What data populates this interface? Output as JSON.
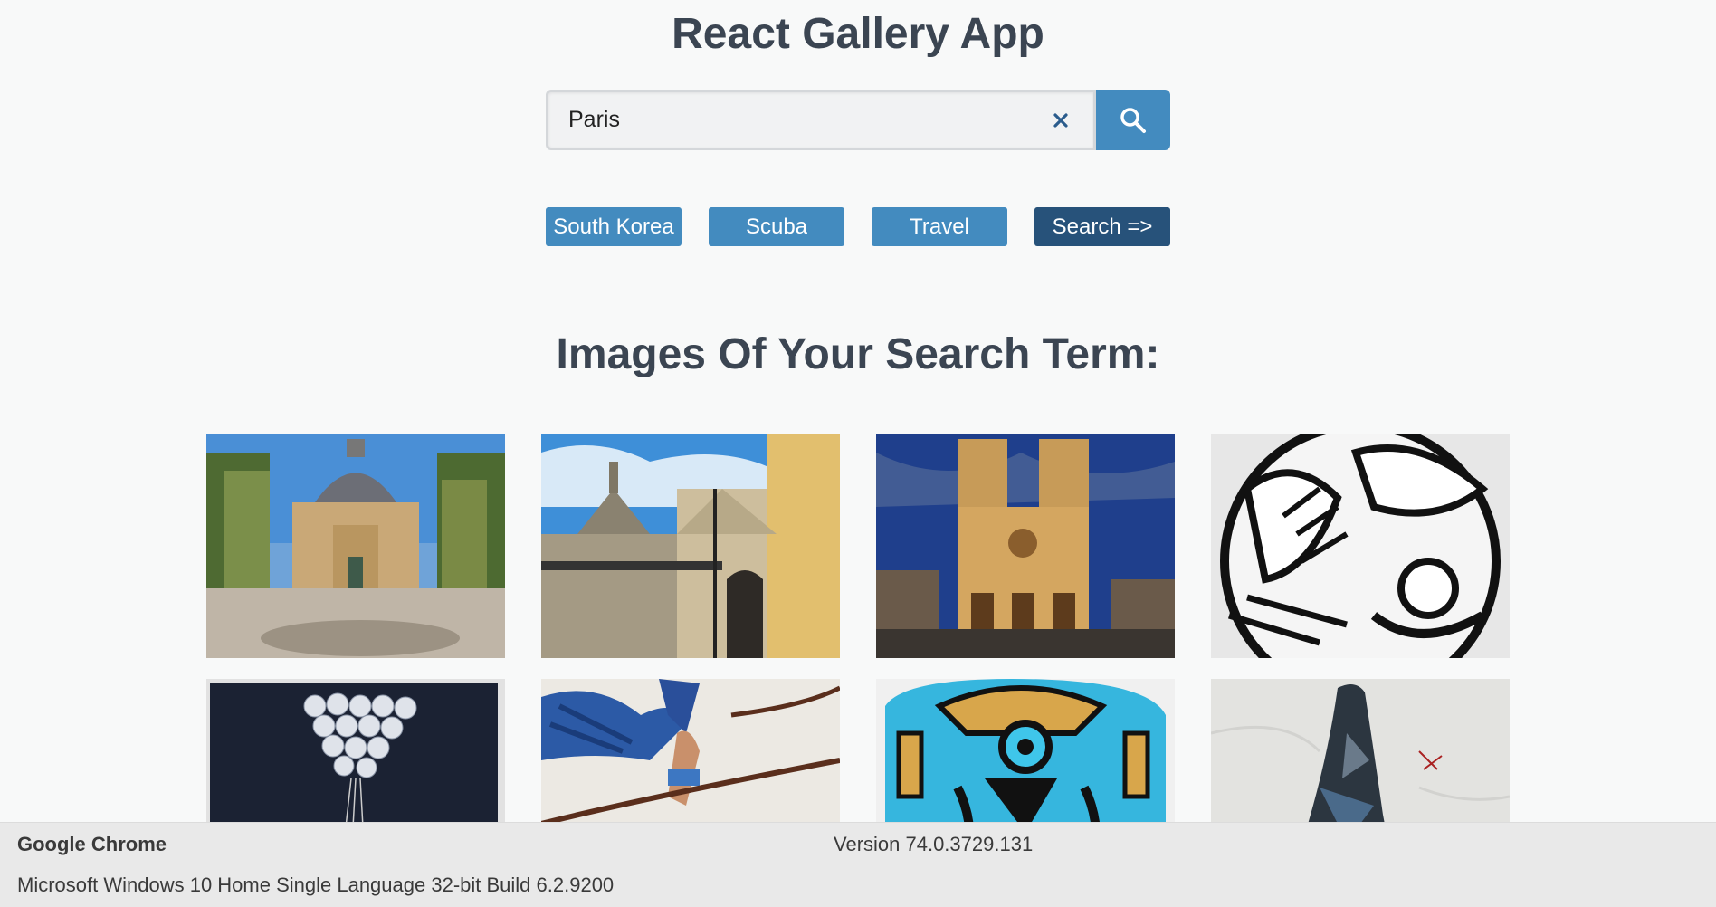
{
  "app": {
    "title": "React Gallery App"
  },
  "search": {
    "value": "Paris",
    "clear_icon": "close-icon",
    "submit_icon": "search-icon"
  },
  "nav": {
    "tags": [
      {
        "label": "South Korea"
      },
      {
        "label": "Scuba"
      },
      {
        "label": "Travel"
      },
      {
        "label": "Search =>"
      }
    ]
  },
  "results": {
    "heading": "Images Of Your Search Term:",
    "photos": [
      {
        "subject": "sorbonne-chapel-photo"
      },
      {
        "subject": "church-street-photo"
      },
      {
        "subject": "notre-dame-night-photo"
      },
      {
        "subject": "black-white-mural-photo"
      },
      {
        "subject": "balloons-street-art-photo"
      },
      {
        "subject": "icarus-eagle-mural-photo"
      },
      {
        "subject": "blue-bird-graffiti-photo"
      },
      {
        "subject": "stencil-figure-art-photo"
      }
    ]
  },
  "footer": {
    "browser": "Google Chrome",
    "version": "Version 74.0.3729.131",
    "os": "Microsoft Windows 10 Home Single Language 32-bit Build 6.2.9200"
  },
  "colors": {
    "accent": "#438bbf",
    "accent_dark": "#27527a",
    "heading": "#3b4552",
    "background": "#f8f9f9"
  }
}
